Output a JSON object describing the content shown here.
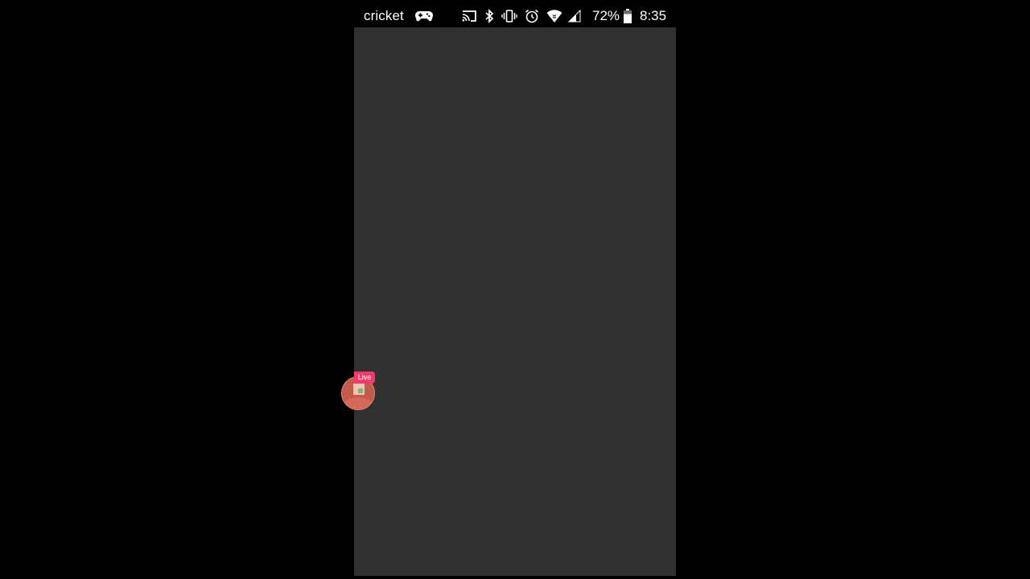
{
  "status_bar": {
    "carrier": "cricket",
    "battery_percent": "72%",
    "battery_level": 0.72,
    "time": "8:35",
    "icons": [
      "gamepad-icon",
      "cast-icon",
      "bluetooth-icon",
      "vibrate-icon",
      "alarm-icon",
      "wifi-icon",
      "signal-icon",
      "battery-icon"
    ]
  },
  "live_bubble": {
    "badge": "Live"
  },
  "colors": {
    "letterbox": "#000000",
    "app_background": "#313131",
    "status_text": "#ffffff",
    "live_badge": "#f2396b",
    "avatar": "#c55a4a"
  }
}
